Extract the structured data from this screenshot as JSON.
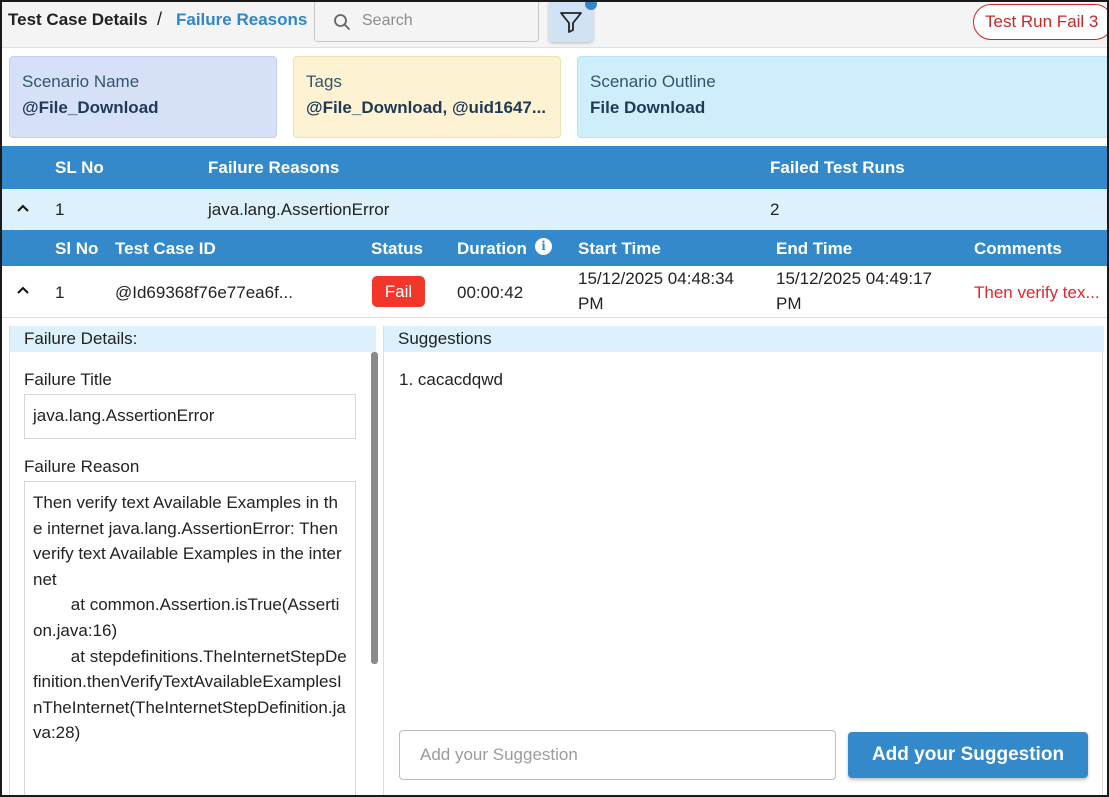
{
  "breadcrumb": {
    "root": "Test Case Details",
    "separator": "/",
    "current": "Failure Reasons"
  },
  "search": {
    "placeholder": "Search"
  },
  "header": {
    "run_badge": "Test Run Fail 3"
  },
  "cards": {
    "scenario_name": {
      "label": "Scenario Name",
      "value": "@File_Download"
    },
    "tags": {
      "label": "Tags",
      "value": "@File_Download, @uid1647..."
    },
    "scenario_outline": {
      "label": "Scenario Outline",
      "value": "File Download"
    }
  },
  "failure_table": {
    "headers": {
      "sl_no": "SL No",
      "reasons": "Failure Reasons",
      "failed_runs": "Failed Test Runs"
    },
    "rows": [
      {
        "sl_no": "1",
        "reason": "java.lang.AssertionError",
        "failed_runs": "2"
      }
    ]
  },
  "runs_table": {
    "headers": {
      "sl_no": "Sl No",
      "case_id": "Test Case ID",
      "status": "Status",
      "duration": "Duration",
      "start": "Start Time",
      "end": "End Time",
      "comments": "Comments"
    },
    "rows": [
      {
        "sl_no": "1",
        "case_id": "@Id69368f76e77ea6f...",
        "status": "Fail",
        "duration": "00:00:42",
        "start_line1": "15/12/2025 04:48:34",
        "start_line2": "PM",
        "end_line1": "15/12/2025 04:49:17",
        "end_line2": "PM",
        "comment": "Then verify tex..."
      }
    ]
  },
  "failure_details": {
    "heading": "Failure Details:",
    "title_label": "Failure Title",
    "title_value": "java.lang.AssertionError",
    "reason_label": "Failure Reason",
    "reason_value": "Then verify text Available Examples in the internet java.lang.AssertionError: Then verify text Available Examples in the internet\n\tat common.Assertion.isTrue(Assertion.java:16)\n\tat stepdefinitions.TheInternetStepDefinition.thenVerifyTextAvailableExamplesInTheInternet(TheInternetStepDefinition.java:28)"
  },
  "suggestions": {
    "heading": "Suggestions",
    "items": [
      "1. cacacdqwd"
    ],
    "input_placeholder": "Add your Suggestion",
    "button_label": "Add your Suggestion"
  },
  "colors": {
    "accent": "#3389c9",
    "fail": "#f2362a",
    "badge": "#c62828"
  }
}
